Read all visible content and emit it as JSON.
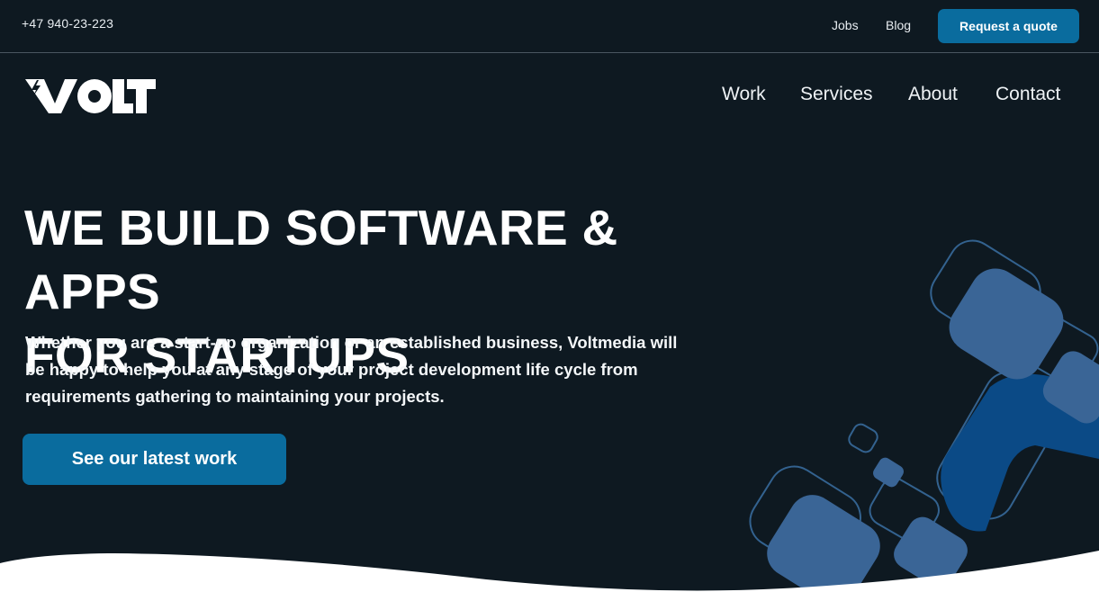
{
  "topbar": {
    "phone": "+47 940-23-223",
    "links": [
      "Jobs",
      "Blog"
    ],
    "quote_button": "Request a quote"
  },
  "brand": {
    "logo_text": "VOLT"
  },
  "nav": {
    "items": [
      "Work",
      "Services",
      "About",
      "Contact"
    ]
  },
  "hero": {
    "title_line1": "WE BUILD SOFTWARE & APPS",
    "title_line2": "FOR STARTUPS",
    "subtitle": "Whether you are a start-up organization or an established business, Voltmedia will be happy to help you at any stage of your project development life cycle from requirements gathering to maintaining your projects.",
    "cta_label": "See our latest work"
  },
  "colors": {
    "background": "#0e1921",
    "accent": "#0a6c9e",
    "shape_light": "#3a6596",
    "shape_dark": "#0b4a86",
    "outline": "#33628f"
  }
}
